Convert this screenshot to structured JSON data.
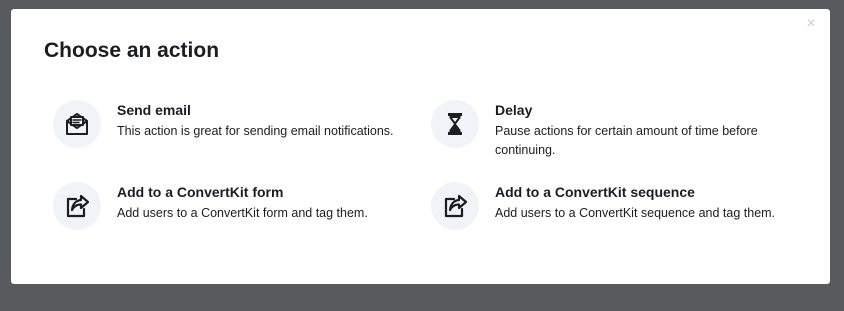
{
  "modal": {
    "title": "Choose an action",
    "close_glyph": "×"
  },
  "actions": [
    {
      "title": "Send email",
      "description": "This action is great for sending email notifications.",
      "icon": "envelope-icon"
    },
    {
      "title": "Delay",
      "description": "Pause actions for certain amount of time before continuing.",
      "icon": "hourglass-icon"
    },
    {
      "title": "Add to a ConvertKit form",
      "description": "Add users to a ConvertKit form and tag them.",
      "icon": "share-icon"
    },
    {
      "title": "Add to a ConvertKit sequence",
      "description": "Add users to a ConvertKit sequence and tag them.",
      "icon": "share-icon"
    }
  ],
  "colors": {
    "backdrop": "#585a5e",
    "modal_bg": "#ffffff",
    "text": "#1b1d21",
    "icon_bg": "#f1f3f9",
    "close": "#c9ced6"
  }
}
